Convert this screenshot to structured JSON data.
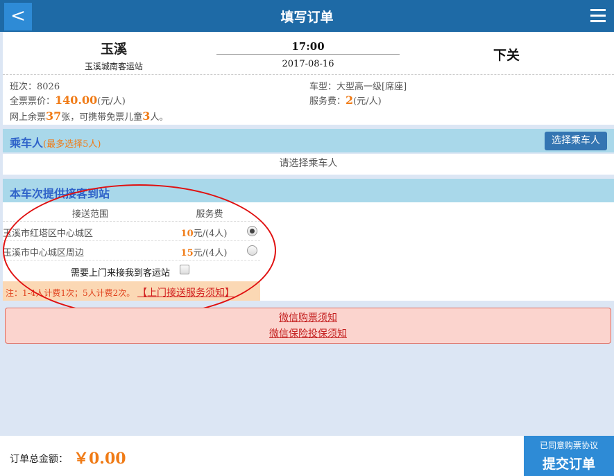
{
  "header": {
    "back_label": "<",
    "title": "填写订单"
  },
  "trip": {
    "from_city": "玉溪",
    "from_station": "玉溪城南客运站",
    "time": "17:00",
    "date": "2017-08-16",
    "to_city": "下关"
  },
  "info": {
    "bus_no_label": "班次：",
    "bus_no": "8026",
    "vehicle_label": "车型：",
    "vehicle": "大型高一级[席座]",
    "price_label": "全票票价：",
    "price": "140.00",
    "price_unit": "(元/人)",
    "fee_label": "服务费：",
    "fee": "2",
    "fee_unit": "(元/人)",
    "remain_pre": "网上余票",
    "remain_count": "37",
    "remain_mid": "张，可携带免票儿童",
    "child_count": "3",
    "remain_post": "人。"
  },
  "passenger": {
    "title": "乘车人",
    "subtitle": "(最多选择5人)",
    "choose_button": "选择乘车人",
    "hint": "请选择乘车人"
  },
  "service": {
    "title": "本车次提供接客到站",
    "col_range": "接送范围",
    "col_fee": "服务费",
    "rows": [
      {
        "area": "玉溪市红塔区中心城区",
        "price": "10",
        "unit": "元/(4人)",
        "selected": true
      },
      {
        "area": "玉溪市中心城区周边",
        "price": "15",
        "unit": "元/(4人)",
        "selected": false
      }
    ],
    "pickup_label": "需要上门来接我到客运站",
    "note_text": "注：1-4人计费1次；5人计费2次。",
    "note_link": "【上门接送服务须知】"
  },
  "notices": {
    "wechat_ticket": "微信购票须知",
    "wechat_insurance": "微信保险投保须知"
  },
  "footer": {
    "total_label": "订单总金额：",
    "total_value": "￥0.00",
    "agreement": "已同意购票协议",
    "submit": "提交订单"
  },
  "colors": {
    "header": "#1e6aa6",
    "accent": "#f07b16",
    "annotation": "#e01010"
  }
}
